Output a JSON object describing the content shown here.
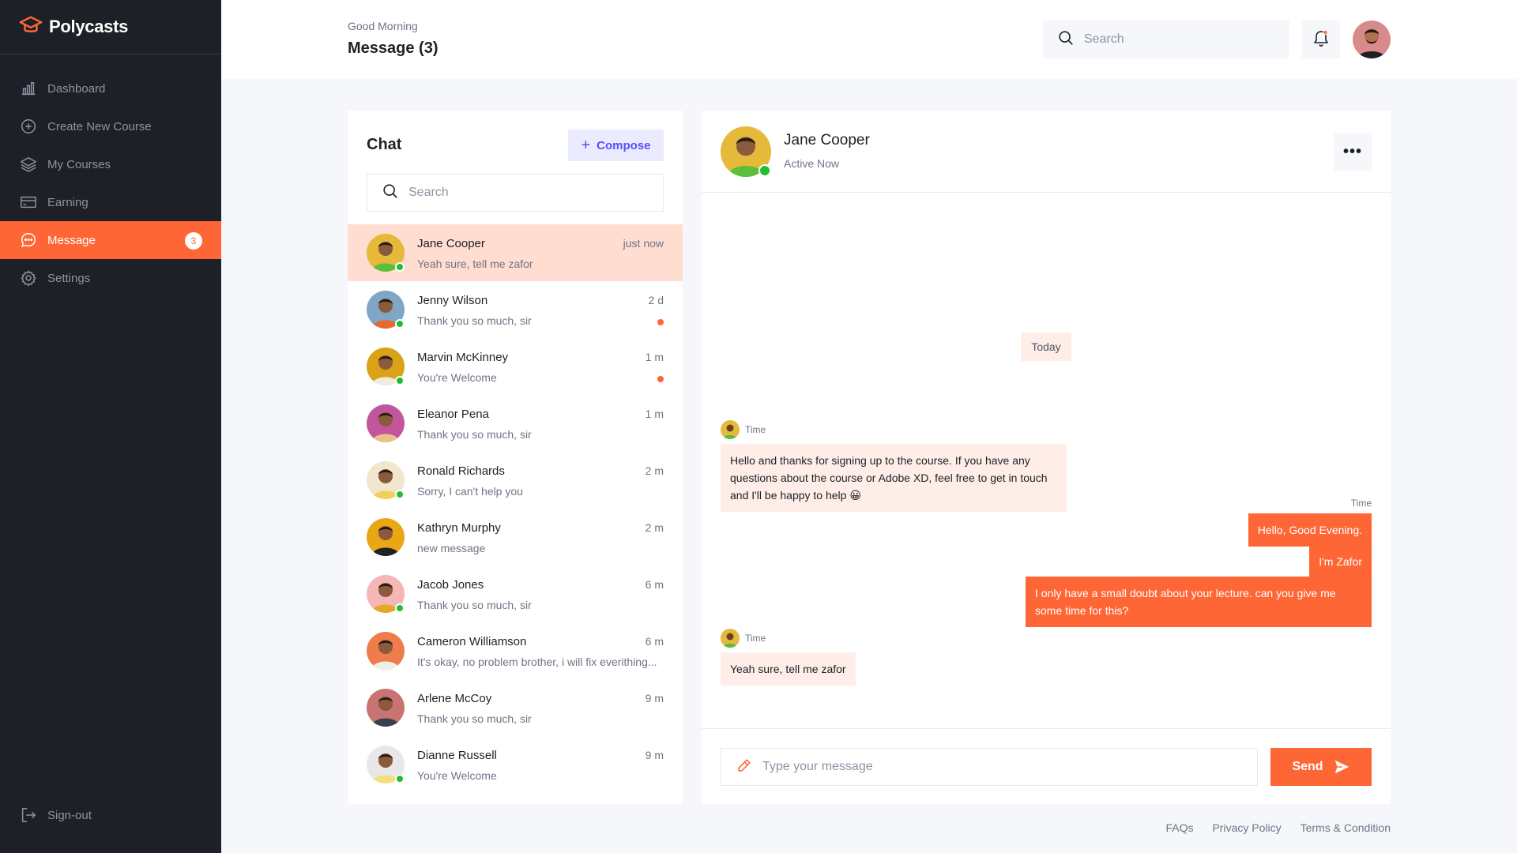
{
  "brand": {
    "name": "Polycasts"
  },
  "sidebar": {
    "items": [
      {
        "label": "Dashboard",
        "icon": "chart-bar-icon"
      },
      {
        "label": "Create New Course",
        "icon": "plus-circle-icon"
      },
      {
        "label": "My Courses",
        "icon": "stack-icon"
      },
      {
        "label": "Earning",
        "icon": "credit-card-icon"
      },
      {
        "label": "Message",
        "icon": "chat-icon",
        "badge": "3",
        "active": true
      },
      {
        "label": "Settings",
        "icon": "gear-icon"
      }
    ],
    "signout_label": "Sign-out"
  },
  "header": {
    "greeting": "Good Morning",
    "title": "Message (3)",
    "search_placeholder": "Search"
  },
  "chat": {
    "title": "Chat",
    "compose_label": "Compose",
    "search_placeholder": "Search",
    "contacts": [
      {
        "name": "Jane Cooper",
        "message": "Yeah sure, tell me zafor",
        "time": "just now",
        "online": true,
        "unread": false,
        "active": true,
        "avatar_bg": "#e5b93a",
        "shirt": "#5bbf3c"
      },
      {
        "name": "Jenny Wilson",
        "message": "Thank you so much, sir",
        "time": "2 d",
        "online": true,
        "unread": true,
        "avatar_bg": "#7fa6c4",
        "shirt": "#e8692f"
      },
      {
        "name": "Marvin McKinney",
        "message": "You're Welcome",
        "time": "1 m",
        "online": true,
        "unread": true,
        "avatar_bg": "#d9a217",
        "shirt": "#f1ebe1"
      },
      {
        "name": "Eleanor Pena",
        "message": "Thank you so much, sir",
        "time": "1 m",
        "online": false,
        "unread": false,
        "avatar_bg": "#c2559c",
        "shirt": "#e8c28a"
      },
      {
        "name": "Ronald Richards",
        "message": "Sorry, I can't help you",
        "time": "2 m",
        "online": true,
        "unread": false,
        "avatar_bg": "#f3e6cf",
        "shirt": "#f2d05e"
      },
      {
        "name": "Kathryn Murphy",
        "message": "new message",
        "time": "2 m",
        "online": false,
        "unread": false,
        "avatar_bg": "#e9a714",
        "shirt": "#222222"
      },
      {
        "name": "Jacob Jones",
        "message": "Thank you so much, sir",
        "time": "6 m",
        "online": true,
        "unread": false,
        "avatar_bg": "#f4b6b6",
        "shirt": "#e2a924"
      },
      {
        "name": "Cameron Williamson",
        "message": "It's okay, no problem brother, i will fix everithing...",
        "time": "6 m",
        "online": false,
        "unread": false,
        "avatar_bg": "#ef7c4b",
        "shirt": "#f2eee8"
      },
      {
        "name": "Arlene McCoy",
        "message": "Thank you so much, sir",
        "time": "9 m",
        "online": false,
        "unread": false,
        "avatar_bg": "#c97373",
        "shirt": "#3b3f4a"
      },
      {
        "name": "Dianne Russell",
        "message": "You're Welcome",
        "time": "9 m",
        "online": true,
        "unread": false,
        "avatar_bg": "#e8e8e8",
        "shirt": "#f2df7c"
      }
    ]
  },
  "conversation": {
    "name": "Jane Cooper",
    "status": "Active Now",
    "day_label": "Today",
    "messages": [
      {
        "side": "in",
        "meta": "Time",
        "text": "Hello and thanks for signing up to the course. If you have any questions about the course or Adobe XD, feel free to get in touch and I'll be happy to help 😀"
      },
      {
        "side": "out",
        "meta": "Time",
        "text": "Hello, Good Evening."
      },
      {
        "side": "out",
        "text": "I'm Zafor"
      },
      {
        "side": "out",
        "text": "I only have a small doubt about your lecture. can you give me some time for this?"
      },
      {
        "side": "in",
        "meta": "Time",
        "text": "Yeah sure, tell me zafor"
      }
    ],
    "input_placeholder": "Type your message",
    "send_label": "Send"
  },
  "footer": {
    "links": [
      "FAQs",
      "Privacy Policy",
      "Terms & Condition"
    ]
  },
  "colors": {
    "accent": "#ff6636",
    "sidebar_bg": "#1d2026",
    "online": "#23bd33",
    "compose_bg": "#ebebff",
    "compose_text": "#564ffd"
  }
}
